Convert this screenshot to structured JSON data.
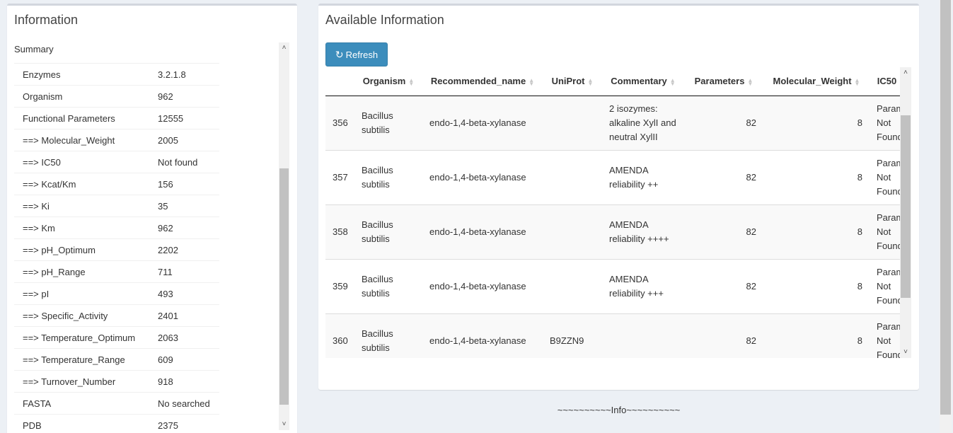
{
  "info_panel": {
    "title": "Information",
    "summary_label": "Summary",
    "rows": [
      {
        "key": "Enzymes",
        "value": "3.2.1.8"
      },
      {
        "key": "Organism",
        "value": "962"
      },
      {
        "key": "Functional Parameters",
        "value": "12555"
      },
      {
        "key": "==> Molecular_Weight",
        "value": "2005"
      },
      {
        "key": "==> IC50",
        "value": "Not found"
      },
      {
        "key": "==> Kcat/Km",
        "value": "156"
      },
      {
        "key": "==> Ki",
        "value": "35"
      },
      {
        "key": "==> Km",
        "value": "962"
      },
      {
        "key": "==> pH_Optimum",
        "value": "2202"
      },
      {
        "key": "==> pH_Range",
        "value": "711"
      },
      {
        "key": "==> pI",
        "value": "493"
      },
      {
        "key": "==> Specific_Activity",
        "value": "2401"
      },
      {
        "key": "==> Temperature_Optimum",
        "value": "2063"
      },
      {
        "key": "==> Temperature_Range",
        "value": "609"
      },
      {
        "key": "==> Turnover_Number",
        "value": "918"
      },
      {
        "key": "FASTA",
        "value": "No searched"
      },
      {
        "key": "PDB",
        "value": "2375"
      }
    ]
  },
  "available_panel": {
    "title": "Available Information",
    "refresh_label": "Refresh",
    "columns": [
      "",
      "Organism",
      "Recommended_name",
      "UniProt",
      "Commentary",
      "Parameters",
      "Molecular_Weight",
      "IC50"
    ],
    "rows": [
      {
        "id": "356",
        "organism": "Bacillus subtilis",
        "name": "endo-1,4-beta-xylanase",
        "uniprot": "",
        "commentary": "2 isozymes: alkaline XylI and neutral XylII",
        "parameters": "82",
        "mw": "8",
        "ic50": "Parameter Not Found"
      },
      {
        "id": "357",
        "organism": "Bacillus subtilis",
        "name": "endo-1,4-beta-xylanase",
        "uniprot": "",
        "commentary": "AMENDA reliability ++",
        "parameters": "82",
        "mw": "8",
        "ic50": "Parameter Not Found"
      },
      {
        "id": "358",
        "organism": "Bacillus subtilis",
        "name": "endo-1,4-beta-xylanase",
        "uniprot": "",
        "commentary": "AMENDA reliability ++++",
        "parameters": "82",
        "mw": "8",
        "ic50": "Parameter Not Found"
      },
      {
        "id": "359",
        "organism": "Bacillus subtilis",
        "name": "endo-1,4-beta-xylanase",
        "uniprot": "",
        "commentary": "AMENDA reliability +++",
        "parameters": "82",
        "mw": "8",
        "ic50": "Parameter Not Found"
      },
      {
        "id": "360",
        "organism": "Bacillus subtilis",
        "name": "endo-1,4-beta-xylanase",
        "uniprot": "B9ZZN9",
        "commentary": "",
        "parameters": "82",
        "mw": "8",
        "ic50": "Parameter Not Found"
      }
    ]
  },
  "footer": {
    "info": "~~~~~~~~~~Info~~~~~~~~~~"
  },
  "colors": {
    "accent": "#3c8dbc",
    "background": "#ecf0f5"
  },
  "icons": {
    "refresh": "refresh-icon",
    "sort": "sort-both-icon"
  }
}
